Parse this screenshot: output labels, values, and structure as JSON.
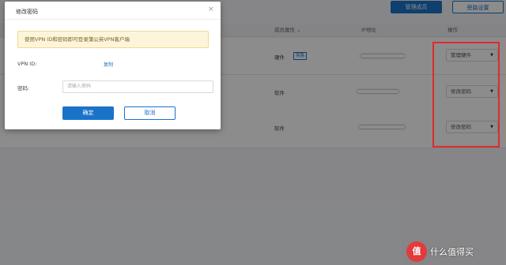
{
  "toolbar": {
    "manage_members": "管理成员",
    "settings": "旁路设置"
  },
  "table": {
    "headers": {
      "member_type": "成员属性",
      "ip": "IP地址",
      "actions": "操作"
    },
    "rows": [
      {
        "type": "硬件",
        "badge": "旁路",
        "action": "管理硬件"
      },
      {
        "type": "软件",
        "badge": "",
        "action": "修改密码"
      },
      {
        "type": "软件",
        "badge": "",
        "action": "修改密码"
      }
    ]
  },
  "modal": {
    "title": "修改密码",
    "notice": "使用VPN ID和密码即可登录蒲公英VPN客户端",
    "vpn_id_label": "VPN ID:",
    "copy_label": "复制",
    "password_label": "密码:",
    "password_placeholder": "请输入密码",
    "confirm": "确定",
    "cancel": "取消"
  },
  "watermark": {
    "logo": "值",
    "text": "什么值得买"
  },
  "icons": {
    "close": "close-icon",
    "caret": "caret-down-icon",
    "sort": "sort-icon"
  },
  "colors": {
    "accent": "#1a73c9",
    "highlight_frame": "#e02b2b"
  }
}
